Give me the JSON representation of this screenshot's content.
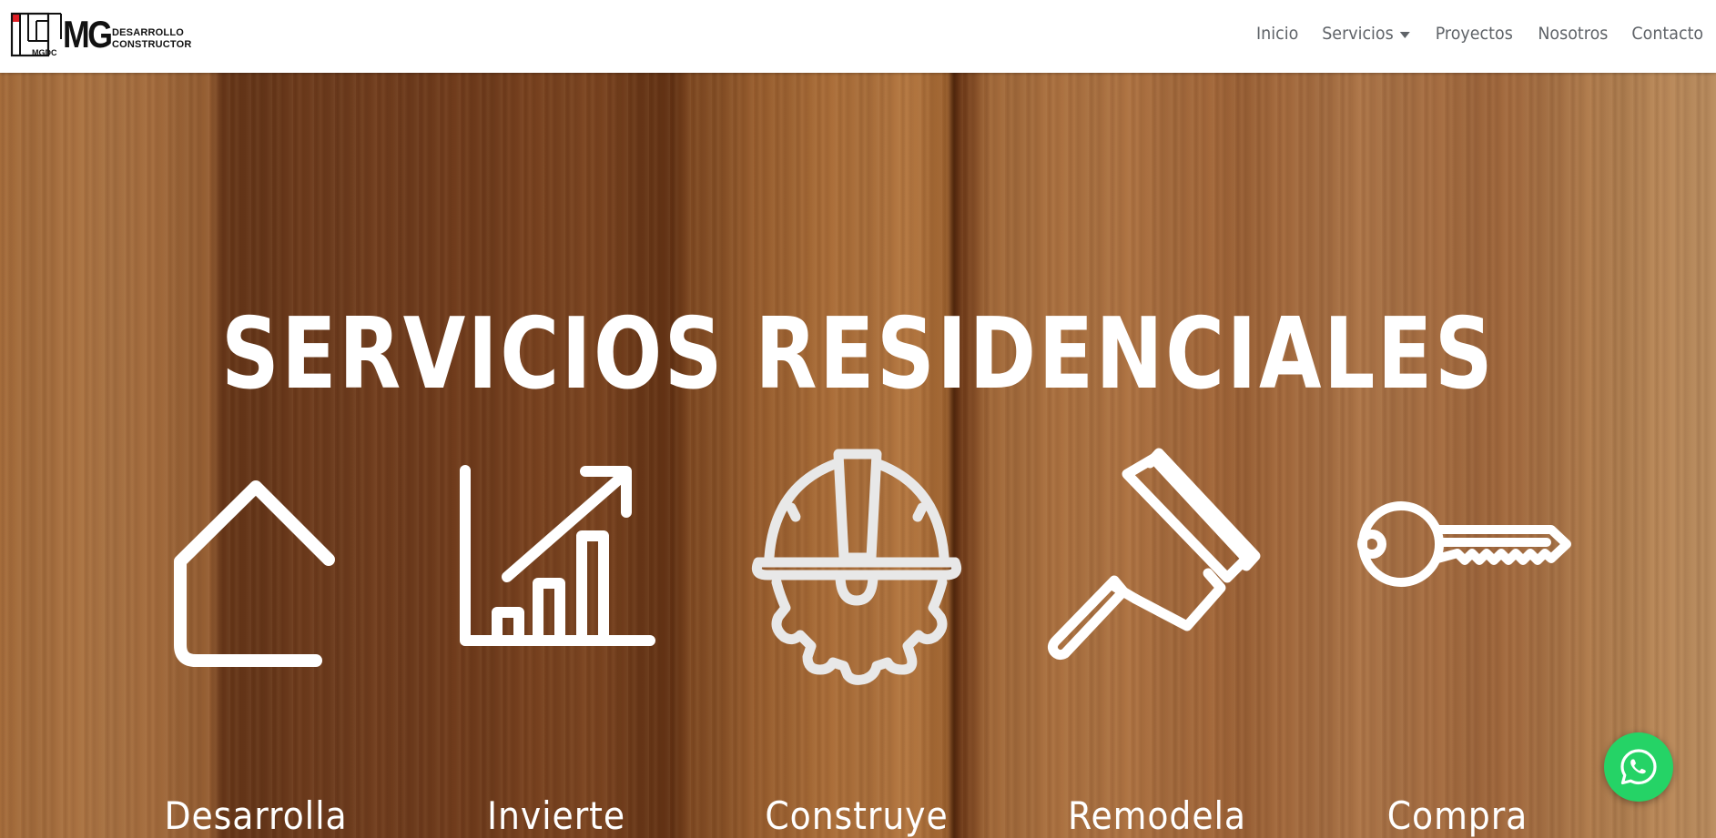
{
  "logo": {
    "mark_text": "MGDC",
    "big_text": "MG",
    "sub_line1": "DESARROLLO",
    "sub_line2": "CONSTRUCTOR"
  },
  "nav": {
    "items": [
      {
        "label": "Inicio"
      },
      {
        "label": "Servicios",
        "has_dropdown": true
      },
      {
        "label": "Proyectos"
      },
      {
        "label": "Nosotros"
      },
      {
        "label": "Contacto"
      }
    ]
  },
  "hero": {
    "title": "SERVICIOS RESIDENCIALES",
    "services": [
      {
        "label": "Desarrolla",
        "icon": "house-icon"
      },
      {
        "label": "Invierte",
        "icon": "growth-chart-icon"
      },
      {
        "label": "Construye",
        "icon": "hard-hat-gear-icon"
      },
      {
        "label": "Remodela",
        "icon": "paint-roller-icon"
      },
      {
        "label": "Compra",
        "icon": "key-icon"
      }
    ]
  },
  "floating": {
    "whatsapp_icon": "whatsapp-icon",
    "whatsapp_color": "#25d366"
  },
  "colors": {
    "nav_text": "#5f6368",
    "hero_text": "#ffffff",
    "logo_accent": "#e01f26"
  }
}
